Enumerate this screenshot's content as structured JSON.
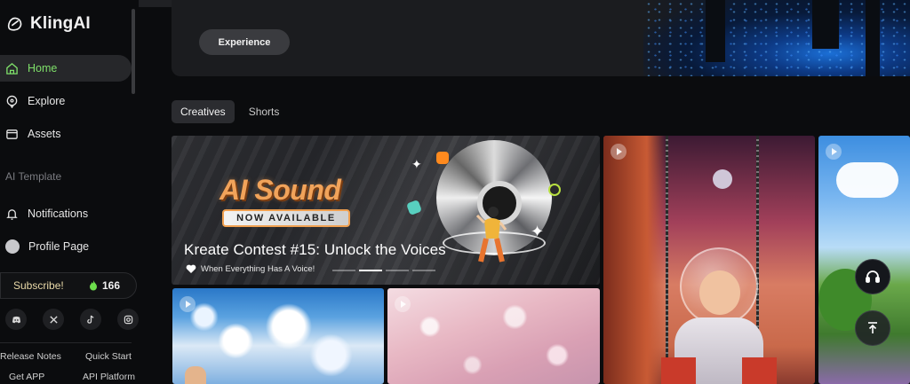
{
  "app": {
    "name": "KlingAI"
  },
  "sidebar": {
    "nav": [
      {
        "label": "Home",
        "icon": "home-icon",
        "active": true
      },
      {
        "label": "Explore",
        "icon": "compass-icon",
        "active": false
      },
      {
        "label": "Assets",
        "icon": "folder-icon",
        "active": false
      }
    ],
    "section_label": "AI Template",
    "notifications_label": "Notifications",
    "profile_label": "Profile Page",
    "subscribe_label": "Subscribe!",
    "credits": "166",
    "social": [
      "discord-icon",
      "x-icon",
      "tiktok-icon",
      "instagram-icon"
    ],
    "footer_links": [
      "Release Notes",
      "Quick Start",
      "Get APP",
      "API Platform"
    ]
  },
  "banner": {
    "button_label": "Experience"
  },
  "tabs": [
    {
      "label": "Creatives",
      "active": true
    },
    {
      "label": "Shorts",
      "active": false
    }
  ],
  "feature": {
    "headline": "AI Sound",
    "badge": "NOW AVAILABLE",
    "title": "Kreate Contest #15: Unlock the Voices",
    "subtitle": "When Everything Has A Voice!",
    "carousel": {
      "total": 4,
      "active_index": 1
    }
  },
  "floating": {
    "support": "headset-icon",
    "back_to_top": "arrow-up-icon"
  },
  "colors": {
    "accent_green": "#7fe06a",
    "subscribe_gold": "#e9d9a8",
    "background": "#0b0c0e"
  }
}
